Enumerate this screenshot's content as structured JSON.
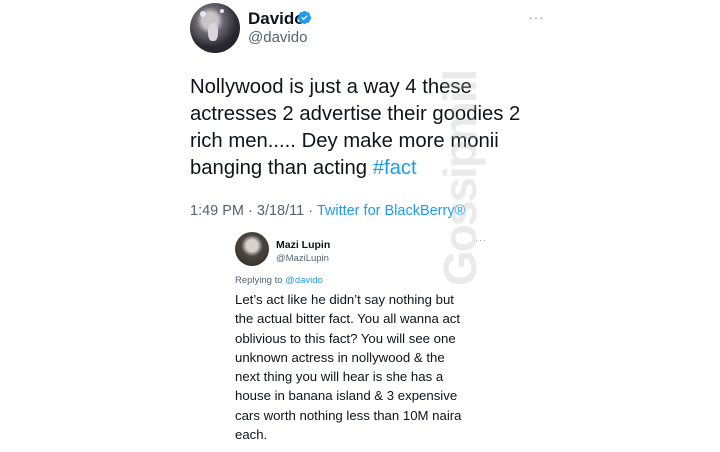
{
  "tweet": {
    "author_name": "Davido",
    "author_handle": "@davido",
    "more_label": "···",
    "text": "Nollywood is just a way 4 these actresses 2 advertise their goodies 2 rich men..... Dey make more monii banging than acting ",
    "hashtag": "#fact",
    "timestamp": "1:49 PM · 3/18/11 · ",
    "source": "Twitter for BlackBerry®",
    "verified_color": "#1d9bf0"
  },
  "reply": {
    "author_name": "Mazi Lupin",
    "author_handle": "@MaziLupin",
    "more_label": "···",
    "replying_prefix": "Replying to ",
    "replying_mention": "@davido",
    "lines": [
      "Let’s act like he didn’t say nothing but",
      "the actual bitter fact. You all wanna act",
      "oblivious to this fact? You will see one",
      "unknown actress in nollywood & the",
      "next thing you will hear is she has a",
      "house in banana island & 3 expensive",
      "cars worth nothing less than 10M naira",
      "each."
    ]
  },
  "watermark": {
    "text": "Gossipmill"
  }
}
